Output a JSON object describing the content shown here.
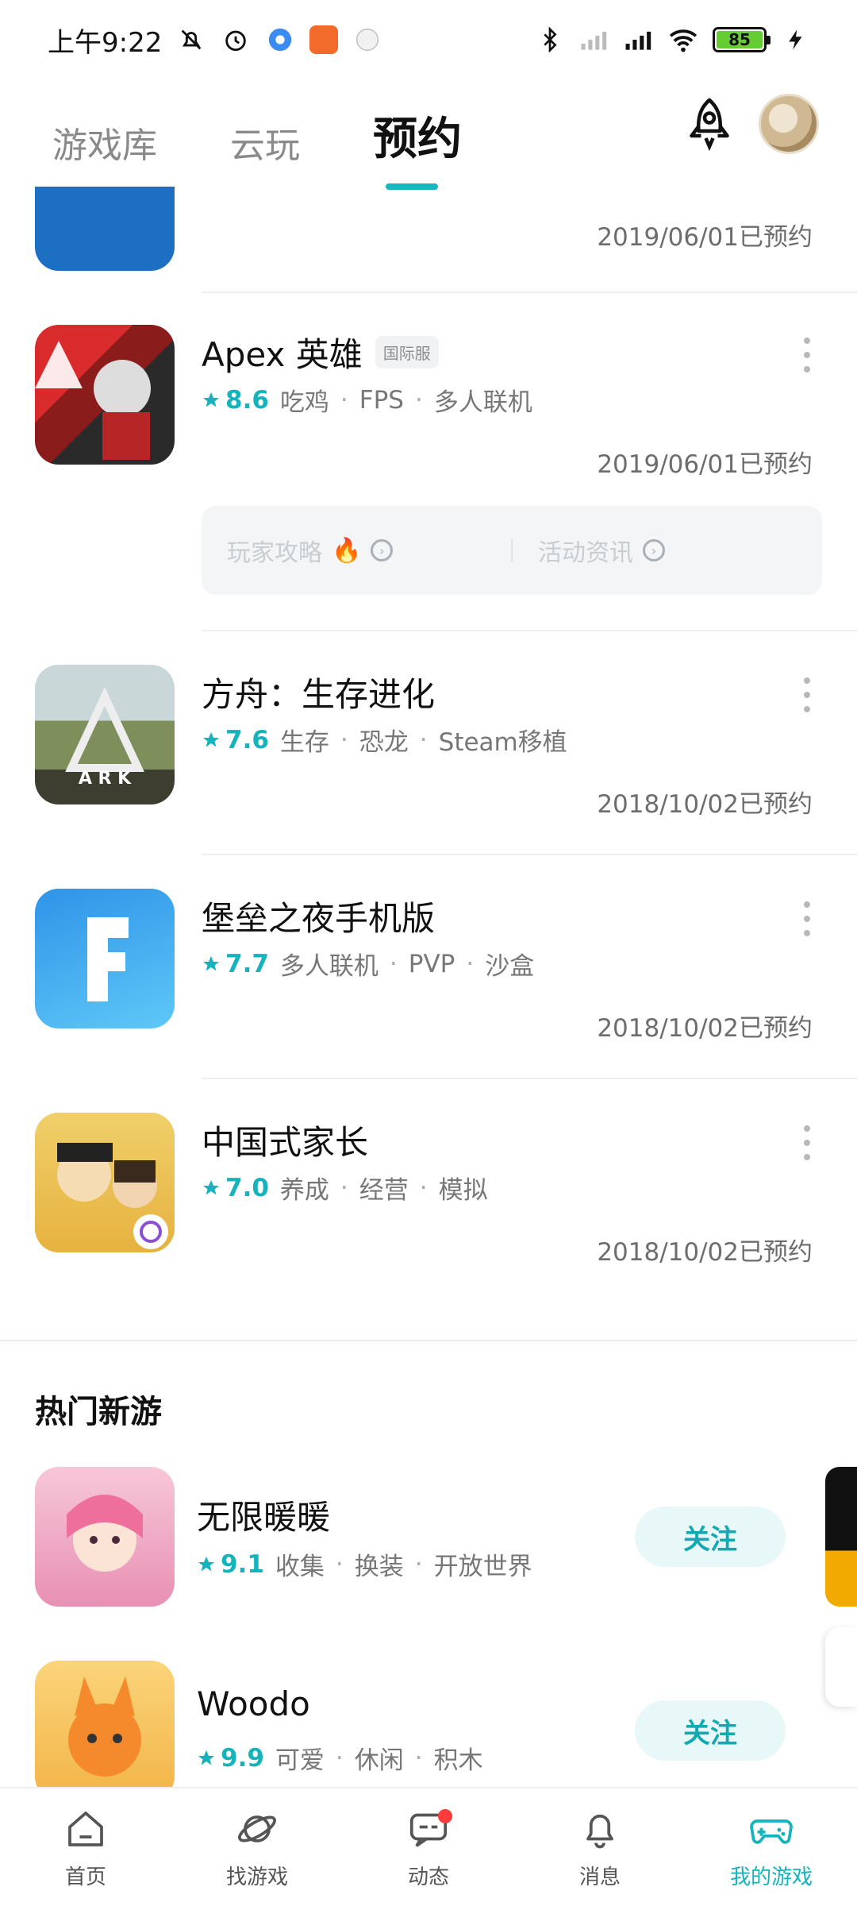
{
  "status_bar": {
    "time": "上午9:22",
    "battery": "85"
  },
  "header": {
    "tabs": [
      {
        "label": "游戏库"
      },
      {
        "label": "云玩"
      },
      {
        "label": "预约"
      }
    ]
  },
  "reserved_games": [
    {
      "name": "",
      "tags": [],
      "date": "2019/06/01已预约"
    },
    {
      "name": "Apex 英雄",
      "badge": "国际服",
      "score": "8.6",
      "tags": [
        "吃鸡",
        "FPS",
        "多人联机"
      ],
      "date": "2019/06/01已预约",
      "sub_links": [
        "玩家攻略",
        "活动资讯"
      ]
    },
    {
      "name": "方舟：生存进化",
      "score": "7.6",
      "tags": [
        "生存",
        "恐龙",
        "Steam移植"
      ],
      "date": "2018/10/02已预约"
    },
    {
      "name": "堡垒之夜手机版",
      "score": "7.7",
      "tags": [
        "多人联机",
        "PVP",
        "沙盒"
      ],
      "date": "2018/10/02已预约"
    },
    {
      "name": "中国式家长",
      "score": "7.0",
      "tags": [
        "养成",
        "经营",
        "模拟"
      ],
      "date": "2018/10/02已预约"
    }
  ],
  "hot_section": {
    "title": "热门新游",
    "games": [
      {
        "name": "无限暖暖",
        "score": "9.1",
        "tags": [
          "收集",
          "换装",
          "开放世界"
        ],
        "action": "关注"
      },
      {
        "name": "Woodo",
        "score": "9.9",
        "tags": [
          "可爱",
          "休闲",
          "积木"
        ],
        "action": "关注"
      }
    ]
  },
  "bottom_nav": [
    {
      "label": "首页"
    },
    {
      "label": "找游戏"
    },
    {
      "label": "动态"
    },
    {
      "label": "消息"
    },
    {
      "label": "我的游戏"
    }
  ]
}
